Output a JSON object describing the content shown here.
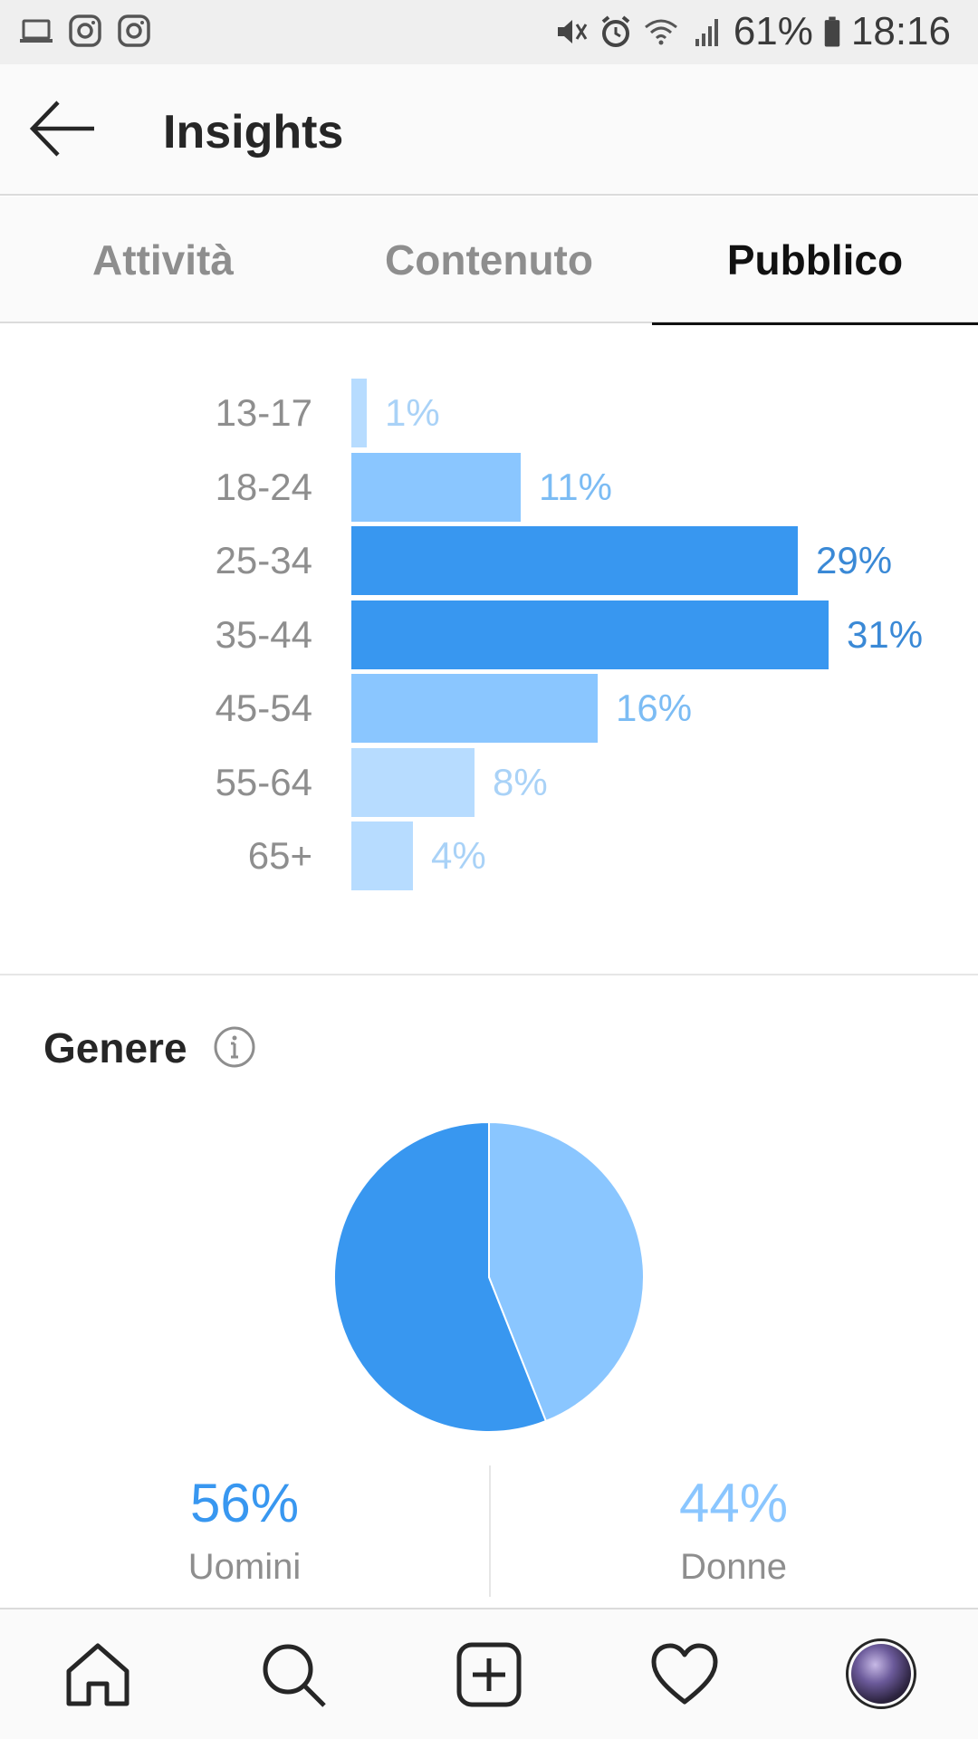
{
  "status_bar": {
    "battery": "61%",
    "time": "18:16",
    "icons_left": [
      "laptop-icon",
      "instagram-icon",
      "instagram-icon"
    ],
    "icons_right": [
      "mute-icon",
      "alarm-icon",
      "wifi-icon",
      "signal-icon",
      "battery-icon"
    ]
  },
  "header": {
    "title": "Insights",
    "back_icon": "arrow-left-icon"
  },
  "tabs": [
    {
      "label": "Attività",
      "active": false
    },
    {
      "label": "Contenuto",
      "active": false
    },
    {
      "label": "Pubblico",
      "active": true
    }
  ],
  "chart_data": [
    {
      "type": "bar",
      "orientation": "horizontal",
      "categories": [
        "13-17",
        "18-24",
        "25-34",
        "35-44",
        "45-54",
        "55-64",
        "65+"
      ],
      "values": [
        1,
        11,
        29,
        31,
        16,
        8,
        4
      ],
      "value_labels": [
        "1%",
        "11%",
        "29%",
        "31%",
        "16%",
        "8%",
        "4%"
      ],
      "title": "",
      "xlabel": "",
      "ylabel": "",
      "xlim": [
        0,
        31
      ],
      "grid": false,
      "colors": {
        "high": "#3897f0",
        "mid": "#8ac6ff",
        "low": "#b7dcff",
        "label_high": "#3a89d6",
        "label_mid": "#7cbcf4",
        "label_low": "#a9d2f7"
      }
    },
    {
      "type": "pie",
      "title": "Genere",
      "categories": [
        "Uomini",
        "Donne"
      ],
      "values": [
        56,
        44
      ],
      "value_labels": [
        "56%",
        "44%"
      ],
      "colors": [
        "#3897f0",
        "#8ac6ff"
      ]
    }
  ],
  "gender": {
    "title": "Genere",
    "info_icon": "info-icon",
    "men_value": "56%",
    "men_label": "Uomini",
    "women_value": "44%",
    "women_label": "Donne",
    "men_color": "#3897f0",
    "women_color": "#8ac6ff"
  },
  "bottom_nav": [
    "home-icon",
    "search-icon",
    "add-icon",
    "heart-icon",
    "profile-avatar"
  ]
}
